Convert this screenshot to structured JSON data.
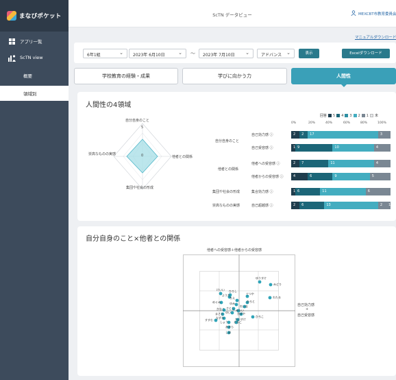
{
  "app": {
    "name": "まなびポケット",
    "page_title": "ScTN データビュー",
    "user": "MEXCBT市教育委員会"
  },
  "sidebar": {
    "items": [
      {
        "label": "アプリ一覧",
        "icon": "grid-icon"
      },
      {
        "label": "ScTN view",
        "icon": "chart-person-icon"
      }
    ],
    "subitems": [
      {
        "label": "概要",
        "active": false
      },
      {
        "label": "領域別",
        "active": true
      }
    ]
  },
  "header": {
    "manual_link": "マニュアルダウンロード"
  },
  "filters": {
    "class": "6年1組",
    "date_from": "2023年 6月10日",
    "separator": "〜",
    "date_to": "2023年 7月10日",
    "mode": "アドバンス",
    "show_button": "表示",
    "excel_button": "Excelダウンロード"
  },
  "tabs": [
    {
      "label": "学校教育の経験・成果",
      "active": false
    },
    {
      "label": "学びに向かう力",
      "active": false
    },
    {
      "label": "人間性",
      "active": true
    }
  ],
  "domains": {
    "title": "人間性の4領域",
    "radar": {
      "axes": [
        "自分自身のこと",
        "他者との関係",
        "集団や社会の形成",
        "崇高なものの実感"
      ],
      "max_label": "5",
      "center_label": "0"
    },
    "legend": {
      "label": "回答",
      "levels": [
        "5",
        "4",
        "3",
        "2",
        "1",
        "未"
      ],
      "colors": [
        "#1f3d4d",
        "#1c6678",
        "#2e8fa3",
        "#43adc0",
        "#7a8793",
        "#e4e6e9"
      ]
    },
    "axis_ticks": [
      "0%",
      "20%",
      "40%",
      "60%",
      "80%",
      "100%"
    ],
    "categories": [
      "自分自身のこと",
      "他者との関係",
      "集団や社会の形成",
      "崇高なものの実感"
    ],
    "rows": [
      {
        "item": "自己効力感 ⓘ",
        "values": [
          2,
          2,
          0,
          17,
          3
        ]
      },
      {
        "item": "自己受容感 ⓘ",
        "values": [
          1,
          9,
          0,
          10,
          4
        ]
      },
      {
        "item": "他者への受容感 ⓘ",
        "values": [
          2,
          7,
          0,
          11,
          4
        ]
      },
      {
        "item": "他者からの受容感 ⓘ",
        "values": [
          4,
          6,
          0,
          9,
          5
        ]
      },
      {
        "item": "集合効力感 ⓘ",
        "values": [
          1,
          6,
          0,
          11,
          6
        ]
      },
      {
        "item": "自己超越感 ⓘ",
        "values": [
          2,
          6,
          0,
          13,
          2,
          1
        ]
      }
    ]
  },
  "scatter": {
    "title": "自分自身のこと×他者との関係",
    "y_label": "他者への受容感＋他者からの受容感",
    "x_label_lines": [
      "自己効力感",
      "+",
      "自己受容感"
    ],
    "points": [
      {
        "name": "ゆうすけ"
      },
      {
        "name": "みどり"
      },
      {
        "name": "わたる"
      },
      {
        "name": "けいい"
      },
      {
        "name": "ひろし"
      },
      {
        "name": "ようた"
      },
      {
        "name": "てつや"
      },
      {
        "name": "めぐみ"
      },
      {
        "name": "ちえ"
      },
      {
        "name": "ひろと"
      },
      {
        "name": "ゆみ"
      },
      {
        "name": "れいな"
      },
      {
        "name": "かなこ"
      },
      {
        "name": "さとし"
      },
      {
        "name": "みらい"
      },
      {
        "name": "まさと"
      },
      {
        "name": "ゆい"
      },
      {
        "name": "かずや"
      },
      {
        "name": "なずな"
      },
      {
        "name": "たいすけ"
      },
      {
        "name": "ひろこ"
      },
      {
        "name": "すすむ"
      },
      {
        "name": "しょう"
      },
      {
        "name": "ともこ"
      },
      {
        "name": "あきら"
      },
      {
        "name": "しほ"
      }
    ]
  }
}
